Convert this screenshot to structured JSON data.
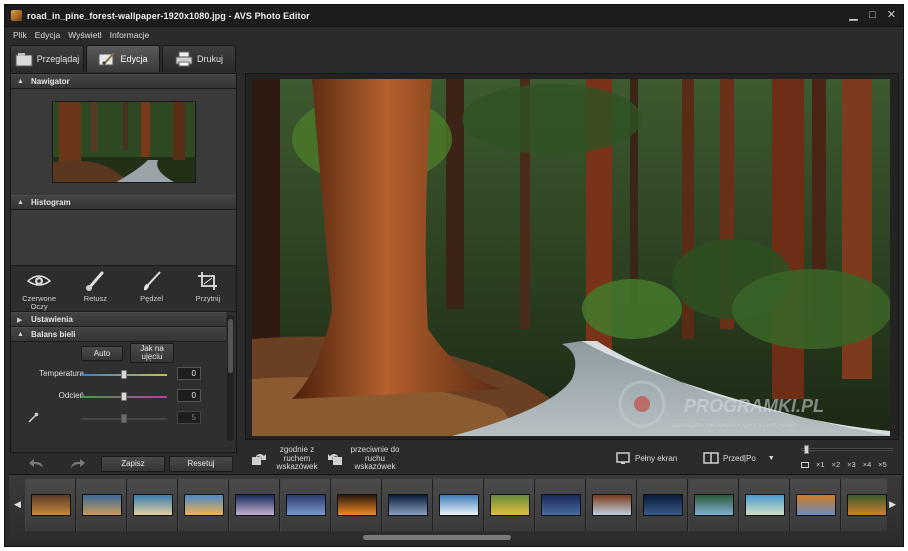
{
  "window": {
    "title": "road_in_pine_forest-wallpaper-1920x1080.jpg - AVS Photo Editor",
    "controls": {
      "minimize": "▁",
      "maximize": "□",
      "close": "✕"
    }
  },
  "menu": [
    {
      "label": "Plik"
    },
    {
      "label": "Edycja"
    },
    {
      "label": "Wyświetl"
    },
    {
      "label": "Informacje"
    }
  ],
  "tabs": [
    {
      "label": "Przeglądaj",
      "active": false
    },
    {
      "label": "Edycja",
      "active": true
    },
    {
      "label": "Drukuj",
      "active": false
    }
  ],
  "panel": {
    "navigator_title": "Nawigator",
    "histogram_title": "Histogram",
    "tools": [
      {
        "label": "Czerwone Oczy",
        "icon": "eye-icon"
      },
      {
        "label": "Retusz",
        "icon": "retouch-brush-icon"
      },
      {
        "label": "Pędzel",
        "icon": "paint-brush-icon"
      },
      {
        "label": "Przytnij",
        "icon": "crop-icon"
      }
    ],
    "settings_title": "Ustawienia",
    "white_balance_title": "Balans bieli",
    "auto_label": "Auto",
    "as_shot_label": "Jak na ujęciu",
    "temperature_label": "Temperatura",
    "temperature_value": "0",
    "tint_label": "Odcień",
    "tint_value": "0",
    "picker_value": "5",
    "save_label": "Zapisz",
    "reset_label": "Resetuj"
  },
  "bottom_toolbar": {
    "rotate_cw_label": "zgodnie z ruchem wskazówek",
    "rotate_ccw_label": "przeciwnie do ruchu wskazówek",
    "fullscreen_label": "Pełny ekran",
    "before_after_label": "Przed|Po",
    "zoom_labels": [
      "×1",
      "×2",
      "×3",
      "×4",
      "×5"
    ]
  },
  "watermark": {
    "title": "PROGRAMKI.PL",
    "subtitle": "DARMOWE PROGRAMY, GRY, STEROWNIKI"
  },
  "filmstrip": {
    "thumb_count": 17
  }
}
